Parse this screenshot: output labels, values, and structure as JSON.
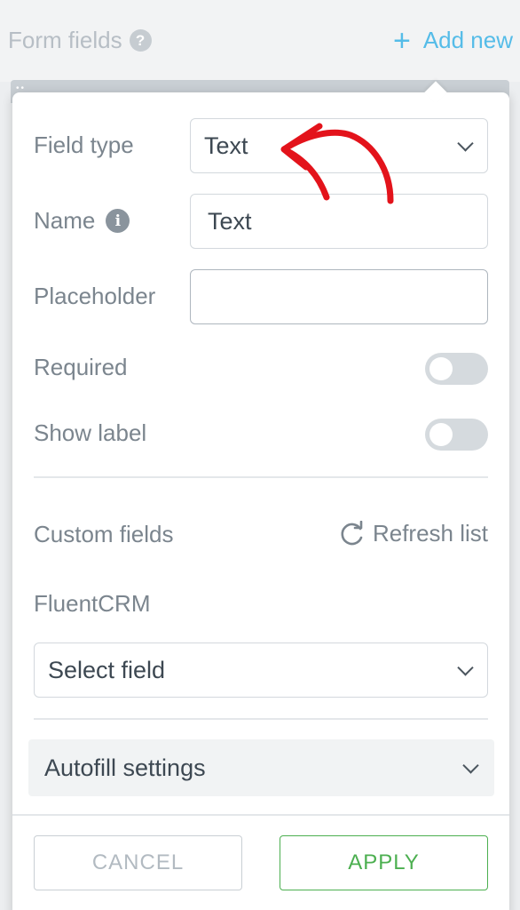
{
  "header": {
    "title": "Form fields",
    "add_new_label": "Add new"
  },
  "popover": {
    "field_type": {
      "label": "Field type",
      "value": "Text"
    },
    "name": {
      "label": "Name",
      "value": "Text"
    },
    "placeholder": {
      "label": "Placeholder",
      "value": ""
    },
    "required": {
      "label": "Required",
      "enabled": false
    },
    "show_label": {
      "label": "Show label",
      "enabled": false
    },
    "custom_fields": {
      "label": "Custom fields",
      "refresh_label": "Refresh list"
    },
    "fluentcrm": {
      "label": "FluentCRM",
      "select_value": "Select field"
    },
    "autofill": {
      "label": "Autofill settings"
    },
    "buttons": {
      "cancel": "CANCEL",
      "apply": "APPLY"
    }
  },
  "colors": {
    "accent_blue": "#55bce8",
    "apply_green": "#4caf50",
    "annotation_red": "#e3131b"
  },
  "icons": [
    "help-icon",
    "plus-icon",
    "info-icon",
    "chevron-down-icon",
    "refresh-icon"
  ]
}
